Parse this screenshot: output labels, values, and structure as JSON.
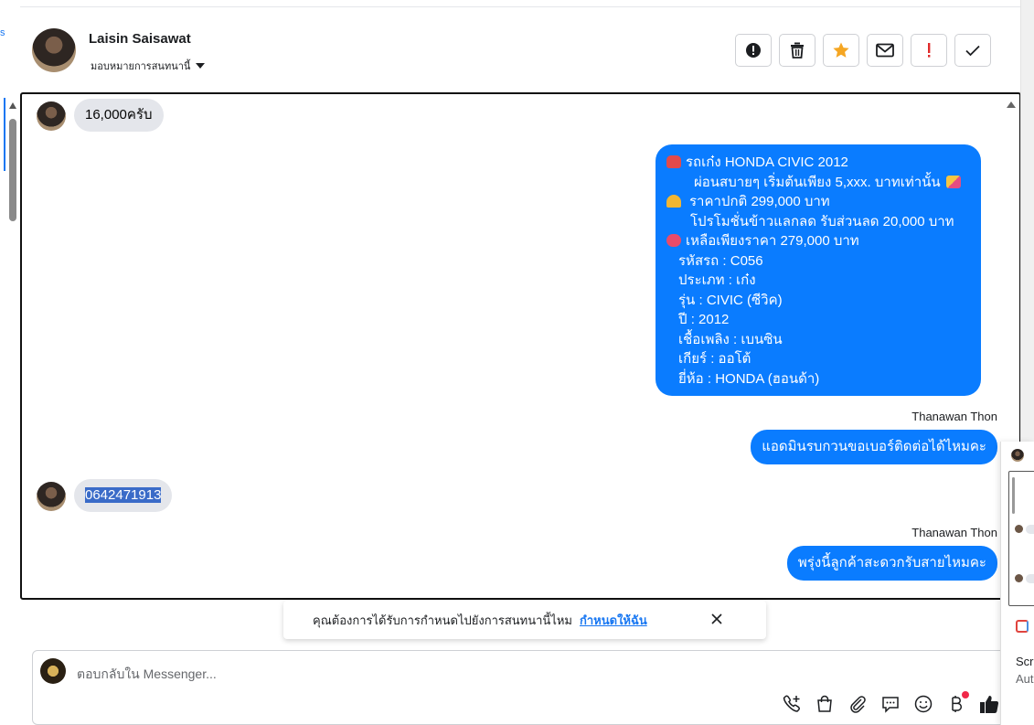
{
  "left_strip": {
    "partial_label": "s"
  },
  "header": {
    "contact_name": "Laisin Saisawat",
    "assign_label": "มอบหมายการสนทนานี้",
    "actions": [
      {
        "name": "spam-report",
        "icon": "exclamation-circle-icon"
      },
      {
        "name": "delete",
        "icon": "trash-icon"
      },
      {
        "name": "star",
        "icon": "star-icon",
        "color": "#f5a623"
      },
      {
        "name": "email",
        "icon": "envelope-icon"
      },
      {
        "name": "mark-important",
        "icon": "exclamation-icon",
        "color": "#e02b2b"
      },
      {
        "name": "mark-done",
        "icon": "check-icon"
      }
    ]
  },
  "messages": {
    "m1": {
      "text": "16,000ครับ"
    },
    "m2": {
      "lines": [
        "รถเก๋ง HONDA CIVIC 2012",
        "ผ่อนสบายๆ เริ่มต้นเพียง 5,xxx. บาทเท่านั้น",
        "ราคาปกติ  299,000 บาท",
        "โปรโมชั่นข้าวแลกลด รับส่วนลด 20,000 บาท",
        "เหลือเพียงราคา 279,000 บาท",
        "รหัสรถ : C056",
        "ประเภท : เก๋ง",
        "รุ่น : CIVIC (ซีวิค)",
        "ปี : 2012",
        "เชื้อเพลิง : เบนซิน",
        "เกียร์ : ออโต้",
        "ยี่ห้อ : HONDA (ฮอนด้า)"
      ]
    },
    "m3": {
      "sender": "Thanawan Thon",
      "text": "แอดมินรบกวนขอเบอร์ติดต่อได้ไหมคะ"
    },
    "m4": {
      "text": "0642471913"
    },
    "m5": {
      "sender": "Thanawan Thon",
      "text": "พรุ่งนี้ลูกค้าสะดวกรับสายไหมคะ"
    }
  },
  "notice": {
    "text": "คุณต้องการได้รับการกำหนดไปยังการสนทนานี้ไหม",
    "link": "กำหนดให้ฉัน"
  },
  "composer": {
    "placeholder": "ตอบกลับใน Messenger...",
    "tools": [
      "phone-add-icon",
      "shopping-bag-icon",
      "paperclip-icon",
      "chat-bubble-icon",
      "smiley-icon",
      "baht-icon",
      "thumbs-up-icon"
    ]
  },
  "side_panel": {
    "text1": "Scre",
    "text2": "Aut"
  },
  "colors": {
    "outgoing": "#0a7cff",
    "incoming": "#e4e6eb",
    "link": "#1877f2"
  }
}
